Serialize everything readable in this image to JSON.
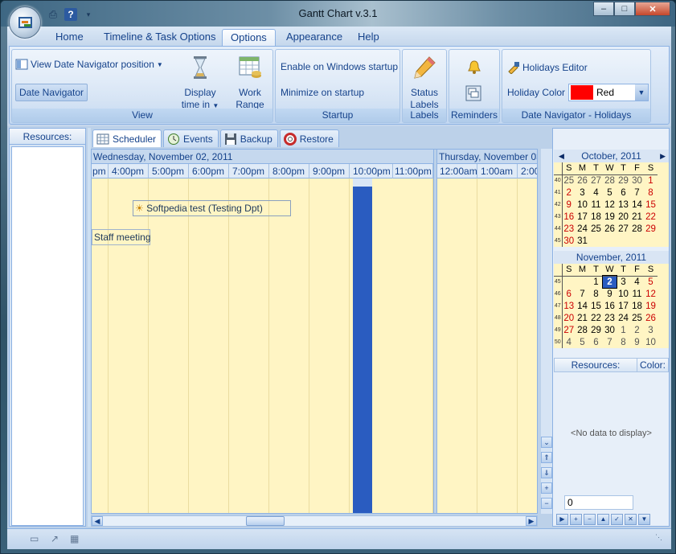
{
  "window": {
    "title": "Gantt Chart v.3.1"
  },
  "ribbon_tabs": [
    {
      "label": "Home"
    },
    {
      "label": "Timeline & Task Options"
    },
    {
      "label": "Options"
    },
    {
      "label": "Appearance"
    },
    {
      "label": "Help"
    }
  ],
  "active_tab": "Options",
  "groups": {
    "view": {
      "label": "View",
      "view_date_navigator_position": "View Date Navigator position",
      "date_navigator": "Date Navigator",
      "display_time_in": "Display time in",
      "work_range_line1": "Work",
      "work_range_line2": "Range"
    },
    "startup": {
      "label": "Startup",
      "enable_windows_startup": "Enable on Windows startup",
      "minimize_on_startup": "Minimize on startup"
    },
    "labels": {
      "label": "Labels",
      "status_labels_line1": "Status",
      "status_labels_line2": "Labels"
    },
    "reminders": {
      "label": "Reminders"
    },
    "holidays": {
      "label": "Date Navigator - Holidays",
      "holidays_editor": "Holidays Editor",
      "holiday_color_label": "Holiday Color",
      "holiday_color_value": "Red",
      "holiday_color_hex": "#ff0000"
    }
  },
  "resources_pane": {
    "header": "Resources:"
  },
  "view_tabs": [
    {
      "label": "Scheduler"
    },
    {
      "label": "Events"
    },
    {
      "label": "Backup"
    },
    {
      "label": "Restore"
    }
  ],
  "scheduler": {
    "day1": {
      "header": "Wednesday, November 02, 2011",
      "hours": [
        "pm",
        "4:00pm",
        "5:00pm",
        "6:00pm",
        "7:00pm",
        "8:00pm",
        "9:00pm",
        "10:00pm",
        "11:00pm"
      ]
    },
    "day2": {
      "header": "Thursday, November 03,",
      "hours": [
        "12:00am",
        "1:00am",
        "2:00"
      ]
    },
    "tasks": [
      {
        "label": "Softpedia test (Testing Dpt)",
        "color": "#f79a8e"
      },
      {
        "label": "Staff meeting",
        "color": "#e8eef7"
      }
    ]
  },
  "calendar": {
    "weekdays": [
      "S",
      "M",
      "T",
      "W",
      "T",
      "F",
      "S"
    ],
    "october": {
      "title": "October, 2011",
      "weeks": [
        {
          "wk": "40",
          "days": [
            "25",
            "26",
            "27",
            "28",
            "29",
            "30",
            "1"
          ]
        },
        {
          "wk": "41",
          "days": [
            "2",
            "3",
            "4",
            "5",
            "6",
            "7",
            "8"
          ]
        },
        {
          "wk": "42",
          "days": [
            "9",
            "10",
            "11",
            "12",
            "13",
            "14",
            "15"
          ]
        },
        {
          "wk": "43",
          "days": [
            "16",
            "17",
            "18",
            "19",
            "20",
            "21",
            "22"
          ]
        },
        {
          "wk": "44",
          "days": [
            "23",
            "24",
            "25",
            "26",
            "27",
            "28",
            "29"
          ]
        },
        {
          "wk": "45",
          "days": [
            "30",
            "31",
            "",
            "",
            "",
            "",
            ""
          ]
        }
      ]
    },
    "november": {
      "title": "November, 2011",
      "selected_day": "2",
      "weeks": [
        {
          "wk": "45",
          "days": [
            "",
            "",
            "1",
            "2",
            "3",
            "4",
            "5"
          ]
        },
        {
          "wk": "46",
          "days": [
            "6",
            "7",
            "8",
            "9",
            "10",
            "11",
            "12"
          ]
        },
        {
          "wk": "47",
          "days": [
            "13",
            "14",
            "15",
            "16",
            "17",
            "18",
            "19"
          ]
        },
        {
          "wk": "48",
          "days": [
            "20",
            "21",
            "22",
            "23",
            "24",
            "25",
            "26"
          ]
        },
        {
          "wk": "49",
          "days": [
            "27",
            "28",
            "29",
            "30",
            "1",
            "2",
            "3"
          ]
        },
        {
          "wk": "50",
          "days": [
            "4",
            "5",
            "6",
            "7",
            "8",
            "9",
            "10"
          ]
        }
      ]
    }
  },
  "resource_color_grid": {
    "col_resources": "Resources:",
    "col_color": "Color:",
    "empty_text": "<No data to display>",
    "count_value": "0"
  }
}
